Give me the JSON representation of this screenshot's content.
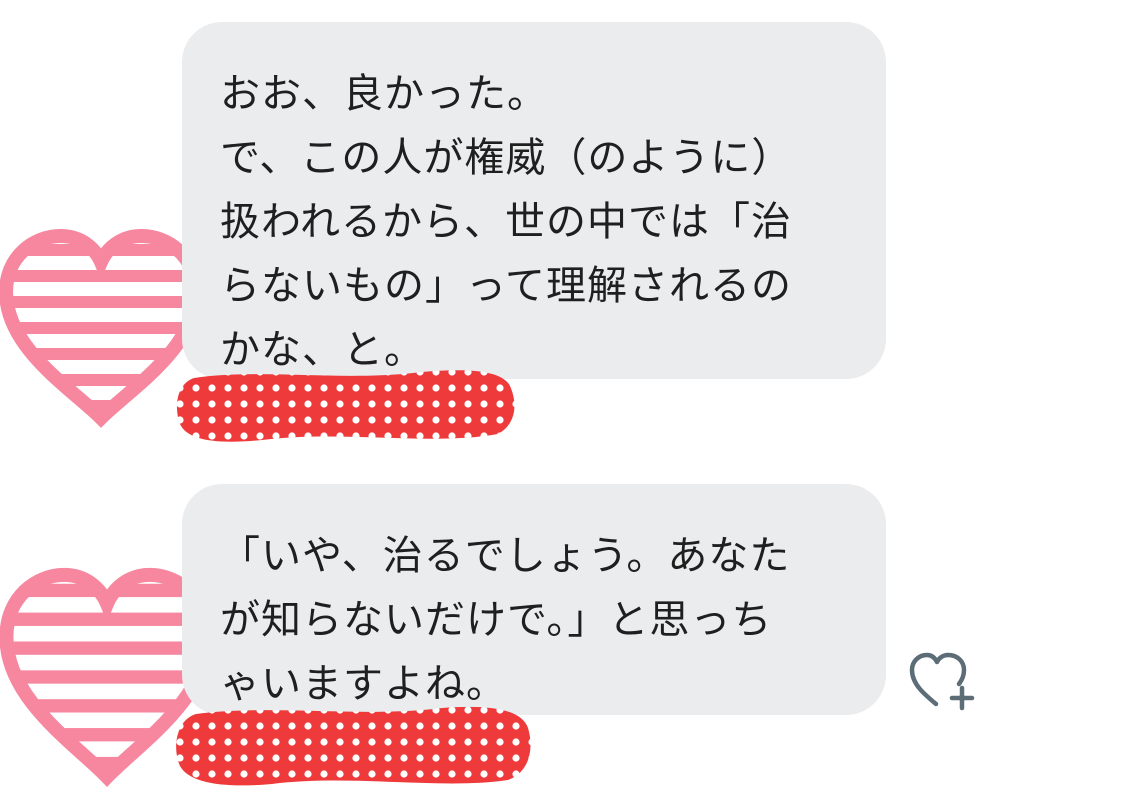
{
  "messages": [
    {
      "lines": [
        "おお、良かった。",
        "で、この人が権威（のように）",
        "扱われるから、世の中では「治",
        "らないもの」って理解されるの",
        "かな、と。"
      ]
    },
    {
      "lines": [
        "「いや、治るでしょう。あなた",
        "が知らないだけで。」と思っち",
        "ゃいますよね。"
      ]
    }
  ],
  "icons": {
    "avatar_sticker": "striped-heart-icon",
    "redaction": "polka-dot-redaction",
    "like_button": "heart-plus-icon"
  },
  "colors": {
    "bubble_background": "#ebecee",
    "text": "#1f1f1f",
    "heart_stripe": "#f7869f",
    "redaction_red": "#ee3a3a",
    "redaction_dot": "#ffffff",
    "like_icon": "#5d6d78"
  }
}
